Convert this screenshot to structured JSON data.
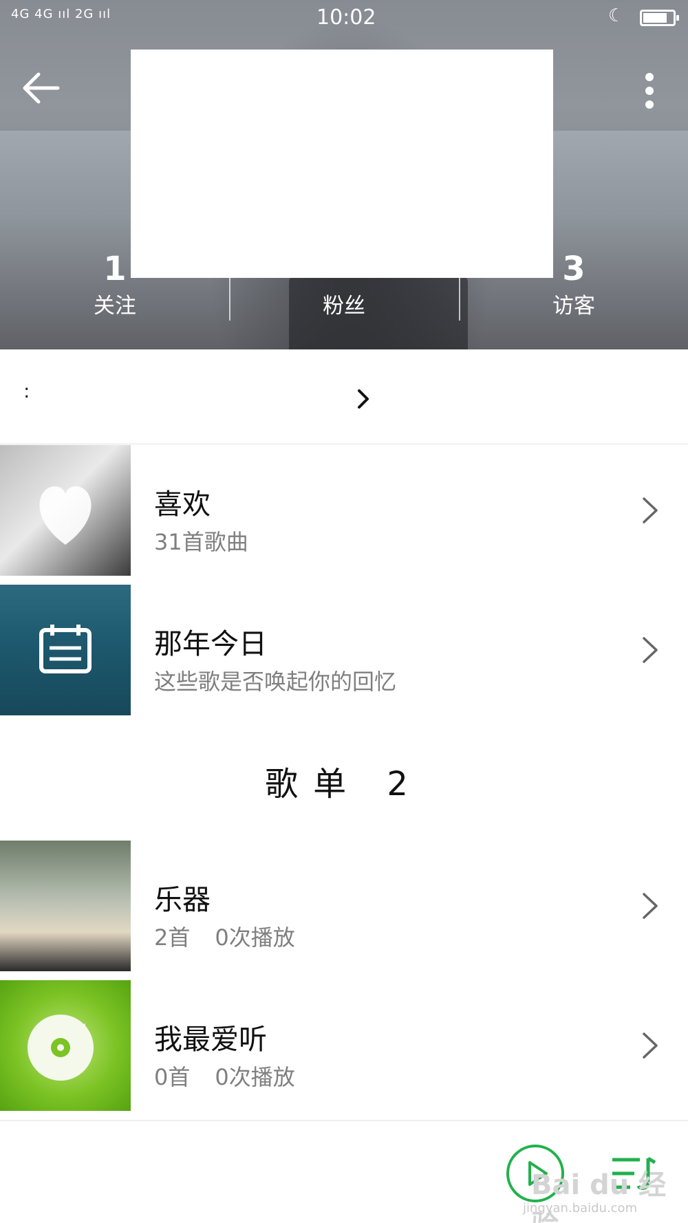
{
  "status_bar": {
    "signal": "4G 4G ııl 2G ııl",
    "time": "10:02"
  },
  "header": {
    "back_icon": "arrow-left-icon",
    "more_icon": "more-vertical-icon"
  },
  "stats": [
    {
      "count": "1",
      "label": "关注"
    },
    {
      "count": "",
      "label": "粉丝"
    },
    {
      "count": "3",
      "label": "访客"
    }
  ],
  "info_row": {
    "prefix": ":"
  },
  "lists": [
    {
      "title": "喜欢",
      "subtitle": "31首歌曲",
      "icon": "heart-icon"
    },
    {
      "title": "那年今日",
      "subtitle": "这些歌是否唤起你的回忆",
      "icon": "calendar-icon"
    }
  ],
  "section": {
    "title": "歌单 2"
  },
  "playlists": [
    {
      "title": "乐器",
      "songs": "2首",
      "plays": "0次播放"
    },
    {
      "title": "我最爱听",
      "songs": "0首",
      "plays": "0次播放"
    }
  ],
  "watermark": {
    "logo": "Bai du 经验",
    "url": "jingyan.baidu.com"
  },
  "colors": {
    "accent": "#22b14c",
    "text_secondary": "#7f7f7f"
  }
}
